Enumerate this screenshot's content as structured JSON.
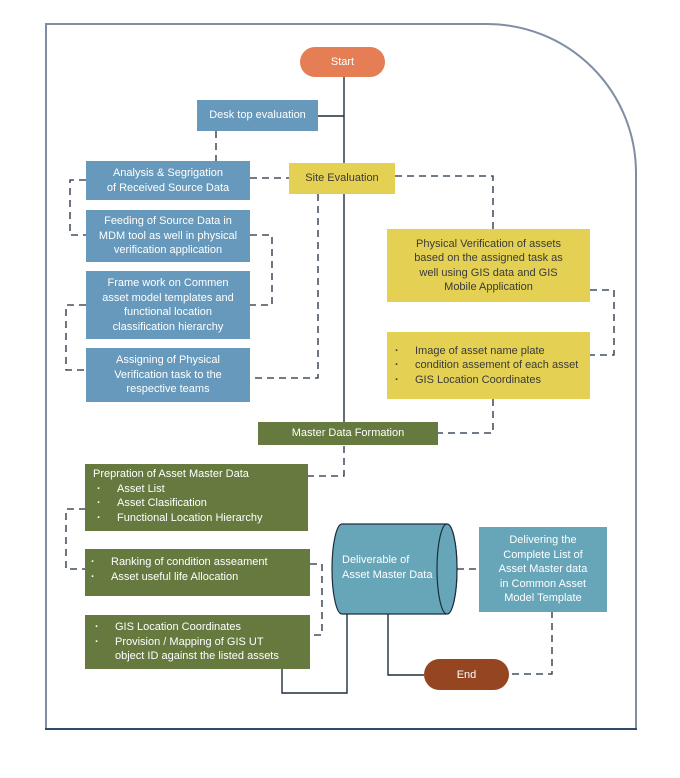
{
  "colors": {
    "blue_box": "#6699bb",
    "yellow_box": "#e4d154",
    "green_box": "#667a3f",
    "teal_box": "#67a5b8",
    "start": "#e57e54",
    "end": "#954520",
    "connector": "#1f2d3d",
    "frame": "#7f8ea3"
  },
  "nodes": {
    "start": "Start",
    "desk_top_evaluation": "Desk top evaluation",
    "site_evaluation": "Site Evaluation",
    "analysis": {
      "line1": "Analysis & Segrigation",
      "line2": "of Received Source Data"
    },
    "feeding": {
      "line1": "Feeding of Source Data in",
      "line2": "MDM tool as well in physical",
      "line3": "verification application"
    },
    "framework": {
      "line1": "Frame work on Commen",
      "line2": "asset model templates and",
      "line3": "functional location",
      "line4": "classification hierarchy"
    },
    "assigning": {
      "line1": "Assigning of Physical",
      "line2": "Verification task to the",
      "line3": "respective teams"
    },
    "physical_verification": {
      "line1": "Physical Verification of assets",
      "line2": "based on the assigned task as",
      "line3": "well using GIS data and GIS",
      "line4": "Mobile Application"
    },
    "verification_outputs": {
      "items": [
        "Image of asset name plate",
        "condition assement of each asset",
        "GIS Location Coordinates"
      ]
    },
    "master_data_formation": "Master Data Formation",
    "preparation": {
      "heading": "Prepration of Asset Master Data",
      "items": [
        "Asset List",
        "Asset Clasification",
        "Functional Location Hierarchy"
      ]
    },
    "ranking": {
      "items": [
        "Ranking of condition asseament",
        "Asset useful life Allocation"
      ]
    },
    "gis_mapping": {
      "items": [
        "GIS Location Coordinates",
        "Provision / Mapping of GIS UT object ID against the listed assets"
      ]
    },
    "deliverable": {
      "line1": "Deliverable of",
      "line2": "Asset Master Data"
    },
    "delivering": {
      "line1": "Delivering the",
      "line2": "Complete List of",
      "line3": "Asset Master data",
      "line4": "in Common Asset",
      "line5": "Model Template"
    },
    "end": "End"
  }
}
